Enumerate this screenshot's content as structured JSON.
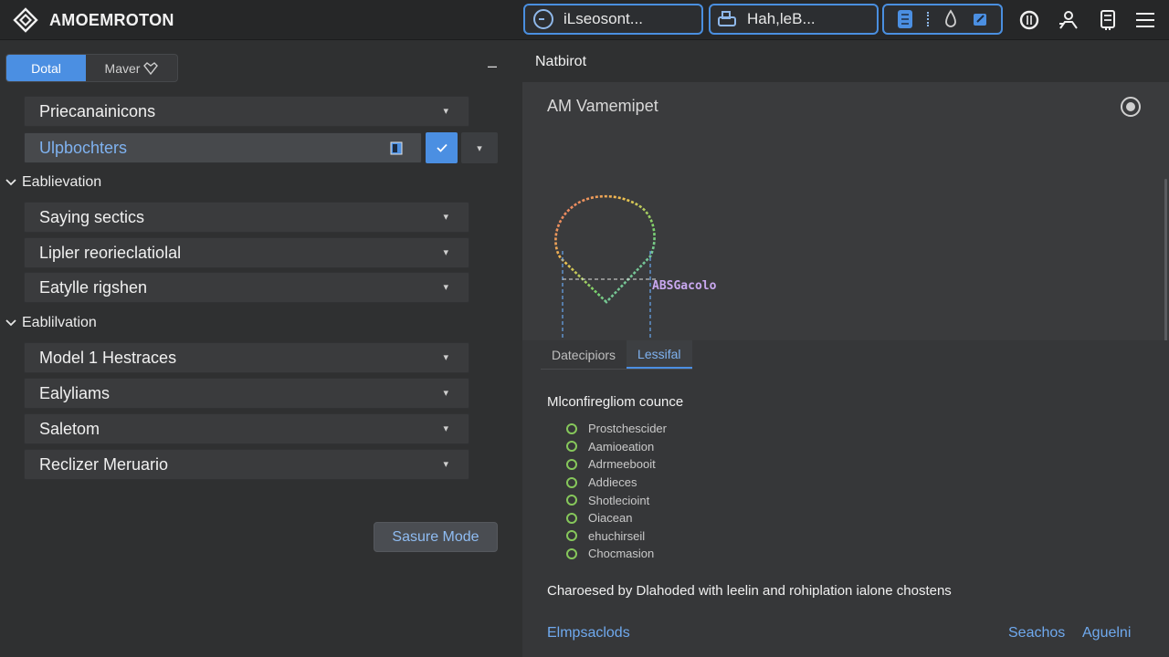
{
  "app": {
    "title": "AMOEMROTON"
  },
  "toolbar": {
    "field1_text": "iLseosont...",
    "field2_text": "Hah,leB...",
    "icons": [
      "grid-icon",
      "drip-icon",
      "cube-icon",
      "circle-icon",
      "user-swap-icon",
      "save-icon",
      "menu-icon"
    ]
  },
  "left": {
    "segment_a": "Dotal",
    "segment_b": "Maver",
    "items_top": [
      {
        "label": "Priecanainicons"
      },
      {
        "label": "Ulpbochters"
      }
    ],
    "group1": {
      "label": "Eablievation",
      "items": [
        {
          "label": "Saying sectics"
        },
        {
          "label": "Lipler reorieclatiolal"
        },
        {
          "label": "Eatylle rigshen"
        }
      ]
    },
    "group2": {
      "label": "Eablilvation",
      "items": [
        {
          "label": "Model 1 Hestraces"
        },
        {
          "label": "Ealyliams"
        },
        {
          "label": "Saletom"
        },
        {
          "label": "Reclizer Meruario"
        }
      ]
    },
    "sure_button": "Sasure Mode"
  },
  "right": {
    "header": "Natbirot",
    "card_title": "AM Vamemipet",
    "figure_label": "ABSGacolo",
    "tabs": [
      "Datecipiors",
      "Lessifal"
    ],
    "section_title": "Mlconfiregliom counce",
    "options": [
      "Prostchescider",
      "Aamioeation",
      "Adrmeebooit",
      "Addieces",
      "Shotlecioint",
      "Oiacean",
      "ehuchirseil",
      "Chocmasion"
    ],
    "description": "Charoesed by Dlahoded with leelin and rohiplation ialone chostens",
    "link_left": "Elmpsaclods",
    "link_mid": "Seachos",
    "link_right": "Aguelni"
  },
  "colors": {
    "accent": "#4b8fe2",
    "background": "#2f3031",
    "option_ring": "#86c75b"
  }
}
